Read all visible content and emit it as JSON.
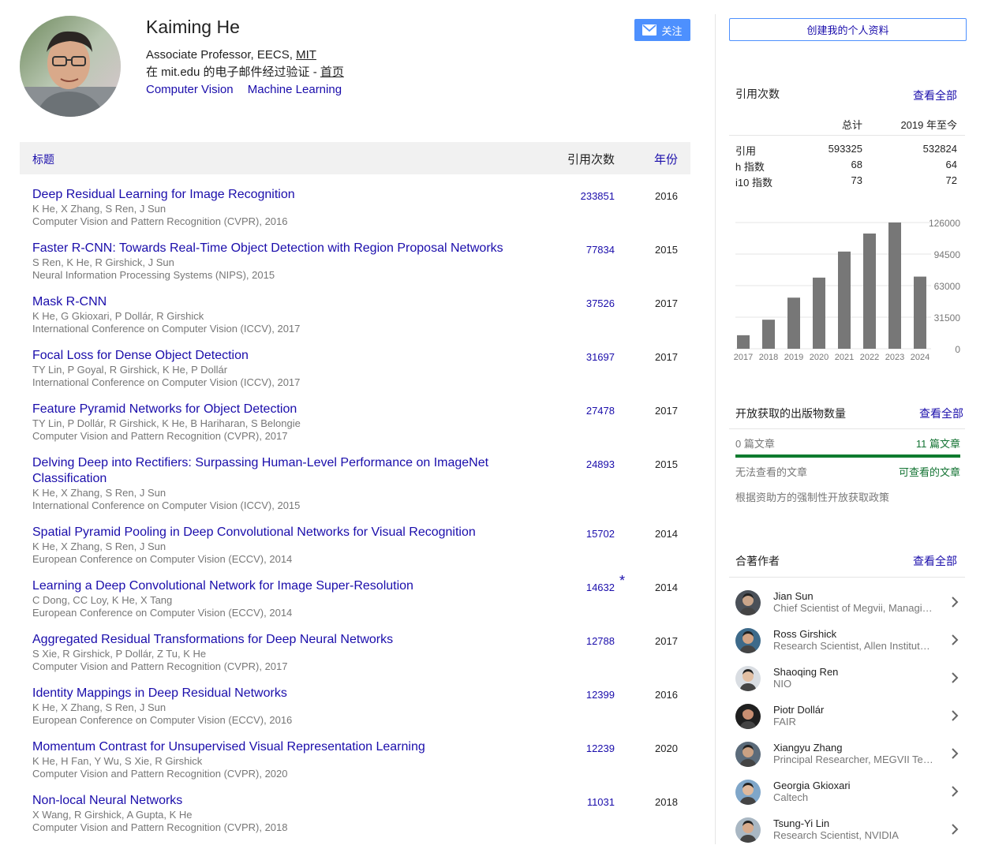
{
  "profile": {
    "name": "Kaiming He",
    "position": "Associate Professor, EECS, ",
    "institution": "MIT",
    "email_verified": "在 mit.edu 的电子邮件经过验证 - ",
    "homepage_label": "首页",
    "interests": [
      "Computer Vision",
      "Machine Learning"
    ],
    "follow_label": "关注",
    "follow_icon": "mail-icon"
  },
  "table": {
    "col_title": "标题",
    "col_cites": "引用次数",
    "col_year": "年份"
  },
  "publications": [
    {
      "title": "Deep Residual Learning for Image Recognition",
      "authors": "K He, X Zhang, S Ren, J Sun",
      "venue": "Computer Vision and Pattern Recognition (CVPR), 2016",
      "cites": "233851",
      "year": "2016",
      "star": ""
    },
    {
      "title": "Faster R-CNN: Towards Real-Time Object Detection with Region Proposal Networks",
      "authors": "S Ren, K He, R Girshick, J Sun",
      "venue": "Neural Information Processing Systems (NIPS), 2015",
      "cites": "77834",
      "year": "2015",
      "star": ""
    },
    {
      "title": "Mask R-CNN",
      "authors": "K He, G Gkioxari, P Dollár, R Girshick",
      "venue": "International Conference on Computer Vision (ICCV), 2017",
      "cites": "37526",
      "year": "2017",
      "star": ""
    },
    {
      "title": "Focal Loss for Dense Object Detection",
      "authors": "TY Lin, P Goyal, R Girshick, K He, P Dollár",
      "venue": "International Conference on Computer Vision (ICCV), 2017",
      "cites": "31697",
      "year": "2017",
      "star": ""
    },
    {
      "title": "Feature Pyramid Networks for Object Detection",
      "authors": "TY Lin, P Dollár, R Girshick, K He, B Hariharan, S Belongie",
      "venue": "Computer Vision and Pattern Recognition (CVPR), 2017",
      "cites": "27478",
      "year": "2017",
      "star": ""
    },
    {
      "title": "Delving Deep into Rectifiers: Surpassing Human-Level Performance on ImageNet Classification",
      "authors": "K He, X Zhang, S Ren, J Sun",
      "venue": "International Conference on Computer Vision (ICCV), 2015",
      "cites": "24893",
      "year": "2015",
      "star": ""
    },
    {
      "title": "Spatial Pyramid Pooling in Deep Convolutional Networks for Visual Recognition",
      "authors": "K He, X Zhang, S Ren, J Sun",
      "venue": "European Conference on Computer Vision (ECCV), 2014",
      "cites": "15702",
      "year": "2014",
      "star": ""
    },
    {
      "title": "Learning a Deep Convolutional Network for Image Super-Resolution",
      "authors": "C Dong, CC Loy, K He, X Tang",
      "venue": "European Conference on Computer Vision (ECCV), 2014",
      "cites": "14632",
      "year": "2014",
      "star": "*"
    },
    {
      "title": "Aggregated Residual Transformations for Deep Neural Networks",
      "authors": "S Xie, R Girshick, P Dollár, Z Tu, K He",
      "venue": "Computer Vision and Pattern Recognition (CVPR), 2017",
      "cites": "12788",
      "year": "2017",
      "star": ""
    },
    {
      "title": "Identity Mappings in Deep Residual Networks",
      "authors": "K He, X Zhang, S Ren, J Sun",
      "venue": "European Conference on Computer Vision (ECCV), 2016",
      "cites": "12399",
      "year": "2016",
      "star": ""
    },
    {
      "title": "Momentum Contrast for Unsupervised Visual Representation Learning",
      "authors": "K He, H Fan, Y Wu, S Xie, R Girshick",
      "venue": "Computer Vision and Pattern Recognition (CVPR), 2020",
      "cites": "12239",
      "year": "2020",
      "star": ""
    },
    {
      "title": "Non-local Neural Networks",
      "authors": "X Wang, R Girshick, A Gupta, K He",
      "venue": "Computer Vision and Pattern Recognition (CVPR), 2018",
      "cites": "11031",
      "year": "2018",
      "star": ""
    }
  ],
  "sidebar": {
    "create_profile_label": "创建我的个人资料",
    "cited_by": {
      "title": "引用次数",
      "see_all": "查看全部",
      "col_total": "总计",
      "col_since": "2019 年至今",
      "rows": [
        {
          "label": "引用",
          "total": "593325",
          "since": "532824"
        },
        {
          "label": "h 指数",
          "total": "68",
          "since": "64"
        },
        {
          "label": "i10 指数",
          "total": "73",
          "since": "72"
        }
      ]
    },
    "open_access": {
      "title": "开放获取的出版物数量",
      "see_all": "查看全部",
      "unavailable_count": "0 篇文章",
      "available_count": "11 篇文章",
      "unavailable_label": "无法查看的文章",
      "available_label": "可查看的文章",
      "available_fraction": 1.0,
      "policy_text": "根据资助方的强制性开放获取政策"
    },
    "coauthors": {
      "title": "合著作者",
      "see_all": "查看全部",
      "items": [
        {
          "name": "Jian Sun",
          "affiliation": "Chief Scientist of Megvii, Managing Director of Megvii Research"
        },
        {
          "name": "Ross Girshick",
          "affiliation": "Research Scientist, Allen Institute for AI"
        },
        {
          "name": "Shaoqing Ren",
          "affiliation": "NIO"
        },
        {
          "name": "Piotr Dollár",
          "affiliation": "FAIR"
        },
        {
          "name": "Xiangyu Zhang",
          "affiliation": "Principal Researcher, MEGVII Technology"
        },
        {
          "name": "Georgia Gkioxari",
          "affiliation": "Caltech"
        },
        {
          "name": "Tsung-Yi Lin",
          "affiliation": "Research Scientist, NVIDIA"
        }
      ]
    }
  },
  "chart_data": {
    "type": "bar",
    "categories": [
      "2017",
      "2018",
      "2019",
      "2020",
      "2021",
      "2022",
      "2023",
      "2024"
    ],
    "values": [
      13500,
      29000,
      51000,
      71000,
      97000,
      115000,
      126000,
      72000
    ],
    "ylim": [
      0,
      126000
    ],
    "yticks": [
      "126000",
      "94500",
      "63000",
      "31500",
      "0"
    ],
    "ytick_values": [
      126000,
      94500,
      63000,
      31500,
      0
    ],
    "grid": true,
    "bar_color": "#777777"
  }
}
